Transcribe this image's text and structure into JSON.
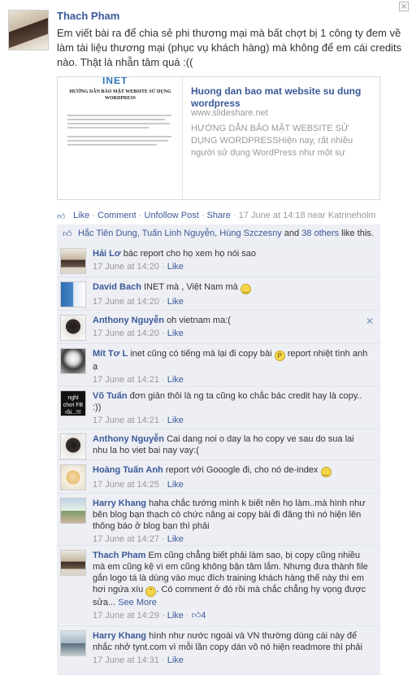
{
  "post": {
    "author": "Thach Pham",
    "text": "Em viết bài ra để chia sẻ phi thương mại mà bất chợt bị 1 công ty đem về làm tài liệu thương mại (phục vụ khách hàng) mà không để em cái credits nào. Thật là nhẫn tâm quá :((",
    "share": {
      "thumb_logo": "INET",
      "thumb_title": "HƯỚNG DẪN BẢO MẬT WEBSITE SỬ DỤNG WORDPRESS",
      "title": "Huong dan bao mat website su dung wordpress",
      "domain": "www.slideshare.net",
      "description": "HƯỚNG DẪN BẢO MẬT WEBSITE SỬ DỤNG WORDPRESSHiện nay, rất nhiều người sử dụng WordPress như một sự"
    },
    "actions": {
      "like": "Like",
      "comment": "Comment",
      "unfollow": "Unfollow Post",
      "share": "Share",
      "time": "17 June at 14:18 near Katrineholm"
    }
  },
  "likes": {
    "people": "Hắc Tiên Dung, Tuấn Linh Nguyễn, Hùng Szczesny",
    "and": "and",
    "others": "38 others",
    "suffix": "like this."
  },
  "comments": [
    {
      "name": "Hải Lơ",
      "text": "bác report cho họ xem họ nói sao",
      "time": "17 June at 14:20",
      "like": "Like"
    },
    {
      "name": "David Bach",
      "text": "INET mà , Việt Nam mà",
      "time": "17 June at 14:20",
      "like": "Like"
    },
    {
      "name": "Anthony Nguyễn",
      "text": "oh vietnam ma:(",
      "time": "17 June at 14:20",
      "like": "Like"
    },
    {
      "name": "Mít Tơ L",
      "text": "inet cũng có tiếng mà lại đi copy bài",
      "text2": "report nhiệt tình anh ạ",
      "time": "17 June at 14:21",
      "like": "Like"
    },
    {
      "name": "Võ Tuấn",
      "text": "đơn giản thôi là ng ta cũng ko chắc bác credit hay là copy.. :))",
      "time": "17 June at 14:21",
      "like": "Like",
      "avatar_text": "nghỉ chơi FB rồi...!!!"
    },
    {
      "name": "Anthony Nguyễn",
      "text": "Cai dang noi o day la ho copy ve sau do sua lai nhu la ho viet bai nay vay:("
    },
    {
      "name": "Hoàng Tuấn Anh",
      "text": "report với Gooogle đi, cho nó de-index",
      "time": "17 June at 14:25",
      "like": "Like"
    },
    {
      "name": "Harry Khang",
      "text": "haha chắc tướng mình k biết nên họ làm..mà hình như bên blog bạn thạch có chức năng ai copy bài đi đăng thì nó hiện lên thông báo ở blog bạn thì phải",
      "time": "17 June at 14:27",
      "like": "Like"
    },
    {
      "name": "Thach Pham",
      "text": "Em cũng chẳng biết phải làm sao, bị copy cũng nhiều mà em cũng kệ vì em cũng không bận tâm lắm. Nhưng đưa thành file gắn logo tá là dùng vào mục đích training khách hàng thế này thì em hơi ngứa xíu",
      "text2": ". Có comment ở đó rồi mà chắc chẳng hy vọng được sửa...",
      "see_more": "See More",
      "time": "17 June at 14:29",
      "like": "Like",
      "likes_count": "4"
    },
    {
      "name": "Harry Khang",
      "text": "hình như nước ngoài và VN thường dùng cái này để nhắc nhở tynt.com vì mỗi lần copy dán vô nó hiện readmore thì phải",
      "time": "17 June at 14:31",
      "like": "Like"
    }
  ]
}
